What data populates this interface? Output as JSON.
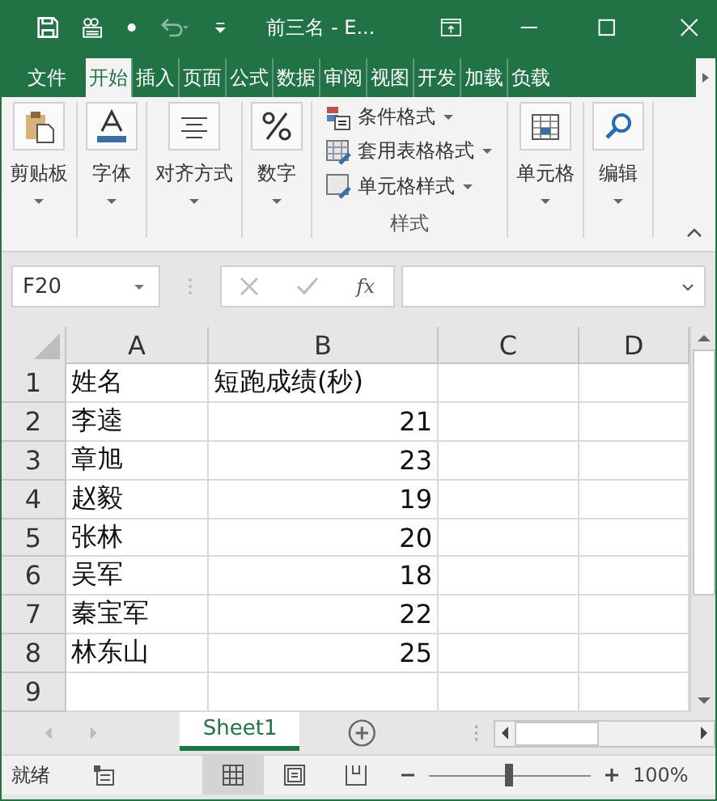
{
  "window": {
    "title": "前三名 - E..."
  },
  "ribbon_tabs": [
    {
      "label": "文件",
      "selected": false
    },
    {
      "label": "开始",
      "selected": true
    },
    {
      "label": "插入",
      "selected": false
    },
    {
      "label": "页面",
      "selected": false
    },
    {
      "label": "公式",
      "selected": false
    },
    {
      "label": "数据",
      "selected": false
    },
    {
      "label": "审阅",
      "selected": false
    },
    {
      "label": "视图",
      "selected": false
    },
    {
      "label": "开发",
      "selected": false
    },
    {
      "label": "加载",
      "selected": false
    },
    {
      "label": "负载",
      "selected": false
    }
  ],
  "ribbon_groups": [
    {
      "kind": "big",
      "label": "剪贴板"
    },
    {
      "kind": "big",
      "label": "字体"
    },
    {
      "kind": "big",
      "label": "对齐方式"
    },
    {
      "kind": "big",
      "label": "数字"
    },
    {
      "kind": "list",
      "label": "样式",
      "items": [
        {
          "label": "条件格式"
        },
        {
          "label": "套用表格格式"
        },
        {
          "label": "单元格样式"
        }
      ]
    },
    {
      "kind": "big",
      "label": "单元格"
    },
    {
      "kind": "big",
      "label": "编辑"
    }
  ],
  "formula_bar": {
    "name_box": "F20",
    "fx": "fx"
  },
  "sheet": {
    "columns": [
      "A",
      "B",
      "C",
      "D"
    ],
    "rows": [
      {
        "number": "1",
        "cells": [
          "姓名",
          "短跑成绩(秒)"
        ]
      },
      {
        "number": "2",
        "cells": [
          "李逵",
          "21"
        ]
      },
      {
        "number": "3",
        "cells": [
          "章旭",
          "23"
        ]
      },
      {
        "number": "4",
        "cells": [
          "赵毅",
          "19"
        ]
      },
      {
        "number": "5",
        "cells": [
          "张林",
          "20"
        ]
      },
      {
        "number": "6",
        "cells": [
          "吴军",
          "18"
        ]
      },
      {
        "number": "7",
        "cells": [
          "秦宝军",
          "22"
        ]
      },
      {
        "number": "8",
        "cells": [
          "林东山",
          "25"
        ]
      },
      {
        "number": "9"
      }
    ]
  },
  "sheet_tabs": [
    {
      "label": "Sheet1",
      "selected": true
    }
  ],
  "status_bar": {
    "status": "就绪",
    "views": [
      {
        "kind": "normal",
        "selected": true
      },
      {
        "kind": "layout",
        "selected": false
      },
      {
        "kind": "pagebreak",
        "selected": false
      }
    ],
    "zoom": {
      "level": 0.5,
      "label": "100%"
    }
  }
}
